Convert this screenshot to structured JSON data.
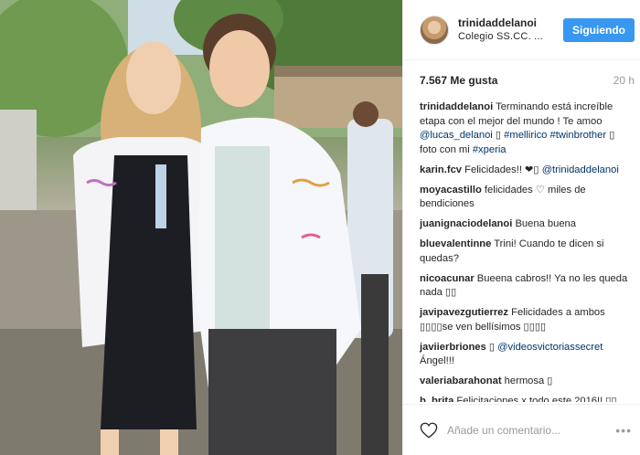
{
  "post": {
    "author": "trinidaddelanoi",
    "location": "Colegio SS.CC. ...",
    "follow_label": "Siguiendo",
    "likes": "7.567 Me gusta",
    "age": "20 h"
  },
  "comments": [
    {
      "user": "trinidaddelanoi",
      "parts": [
        {
          "t": "Terminando está increíble etapa con el mejor del mundo ! Te amoo "
        },
        {
          "t": "@lucas_delanoi",
          "link": true
        },
        {
          "t": " ▯ "
        },
        {
          "t": "#mellirico",
          "link": true
        },
        {
          "t": " "
        },
        {
          "t": "#twinbrother",
          "link": true
        },
        {
          "t": " ▯ foto con mi "
        },
        {
          "t": "#xperia",
          "link": true
        }
      ]
    },
    {
      "user": "karin.fcv",
      "parts": [
        {
          "t": "Felicidades!! ❤▯ "
        },
        {
          "t": "@trinidaddelanoi",
          "link": true
        }
      ]
    },
    {
      "user": "moyacastillo",
      "parts": [
        {
          "t": "felicidades ♡ miles de bendiciones"
        }
      ]
    },
    {
      "user": "juanignaciodelanoi",
      "parts": [
        {
          "t": "Buena buena"
        }
      ]
    },
    {
      "user": "bluevalentinne",
      "parts": [
        {
          "t": "Trini! Cuando te dicen si quedas?"
        }
      ]
    },
    {
      "user": "nicoacunar",
      "parts": [
        {
          "t": "Bueena cabros!! Ya no les queda nada ▯▯"
        }
      ]
    },
    {
      "user": "javipavezgutierrez",
      "parts": [
        {
          "t": "Felicidades a ambos ▯▯▯▯se ven bellísimos ▯▯▯▯"
        }
      ]
    },
    {
      "user": "javiierbriones",
      "parts": [
        {
          "t": "▯ "
        },
        {
          "t": "@videosvictoriassecret",
          "link": true
        },
        {
          "t": " Ángel!!!"
        }
      ]
    },
    {
      "user": "valeriabarahonat",
      "parts": [
        {
          "t": "hermosa ▯"
        }
      ]
    },
    {
      "user": "b_brita",
      "parts": [
        {
          "t": "Felicitaciones x todo este 2016!! ▯▯"
        }
      ]
    }
  ],
  "footer": {
    "placeholder": "Añade un comentario...",
    "more_label": "•••",
    "heart_icon": "heart-outline-icon"
  },
  "colors": {
    "accent": "#3897f0",
    "link": "#003569",
    "text": "#262626",
    "muted": "#999999"
  }
}
